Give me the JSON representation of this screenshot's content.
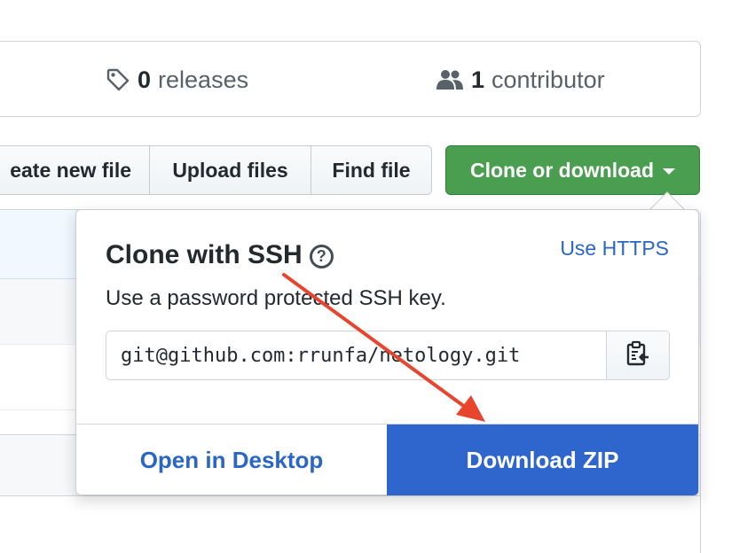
{
  "summary": {
    "releases_count": "0",
    "releases_label": "releases",
    "contributors_count": "1",
    "contributors_label": "contributor"
  },
  "toolbar": {
    "create_file_label": "eate new file",
    "upload_label": "Upload files",
    "find_label": "Find file",
    "clone_label": "Clone or download"
  },
  "clone_dropdown": {
    "title": "Clone with SSH",
    "help_glyph": "?",
    "switch_label": "Use HTTPS",
    "description": "Use a password protected SSH key.",
    "url": "git@github.com:rrunfa/netology.git",
    "open_desktop_label": "Open in Desktop",
    "download_zip_label": "Download ZIP"
  },
  "icons": {
    "releases": "tag-icon",
    "contributors": "people-icon",
    "copy": "clipboard-icon",
    "help": "question-circle-icon"
  },
  "colors": {
    "clone_button": "#4a9e4f",
    "download_button": "#2f66ce",
    "link": "#2a66c8",
    "annotation_arrow": "#e8452f"
  }
}
